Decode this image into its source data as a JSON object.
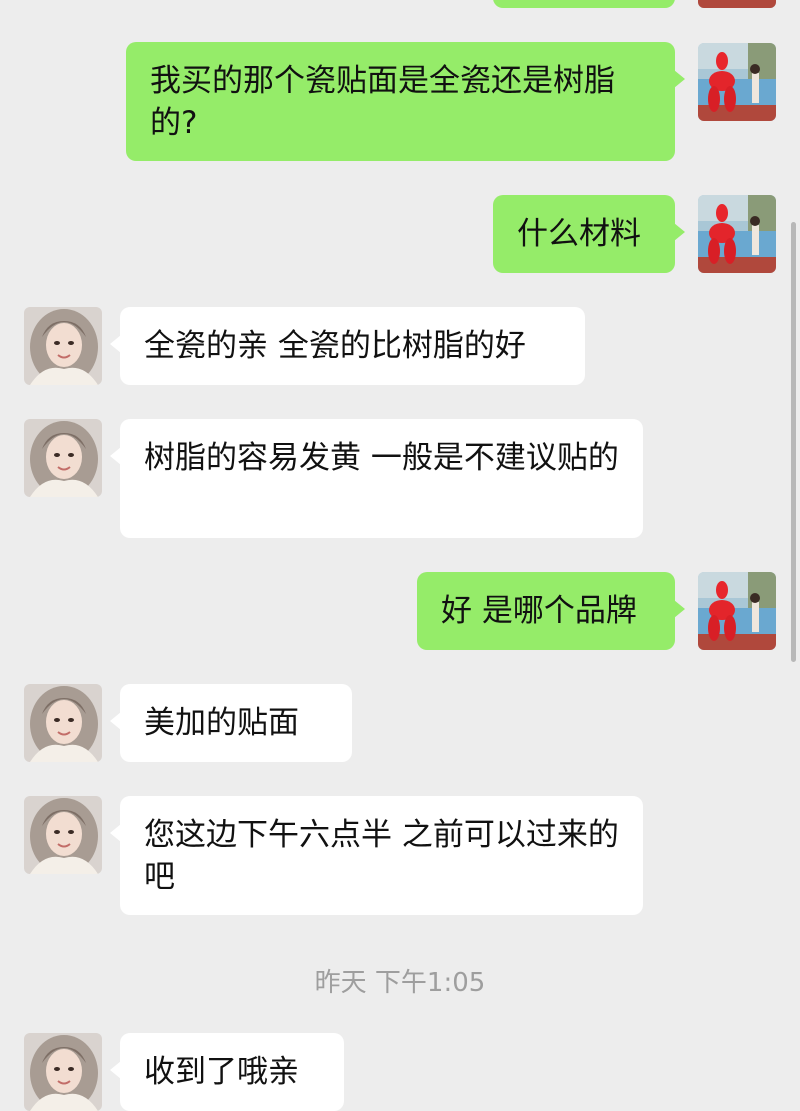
{
  "messages": [
    {
      "side": "me",
      "text": "我买的那个瓷贴面是全瓷还是树脂的?"
    },
    {
      "side": "me",
      "text": "什么材料"
    },
    {
      "side": "other",
      "text": "全瓷的亲 全瓷的比树脂的好"
    },
    {
      "side": "other",
      "text": "树脂的容易发黄 一般是不建议贴的"
    },
    {
      "side": "me",
      "text": "好 是哪个品牌"
    },
    {
      "side": "other",
      "text": "美加的贴面"
    },
    {
      "side": "other",
      "text": "您这边下午六点半 之前可以过来的吧"
    },
    {
      "side": "other",
      "text": "收到了哦亲"
    }
  ],
  "timestamp": "昨天 下午1:05",
  "colors": {
    "background": "#ededed",
    "my_bubble": "#95ec69",
    "other_bubble": "#ffffff",
    "timestamp": "#9e9e9e"
  },
  "icons": {
    "my_avatar": "avatar-red-balloon-dog-photo",
    "other_avatar": "avatar-woman-portrait-photo"
  }
}
